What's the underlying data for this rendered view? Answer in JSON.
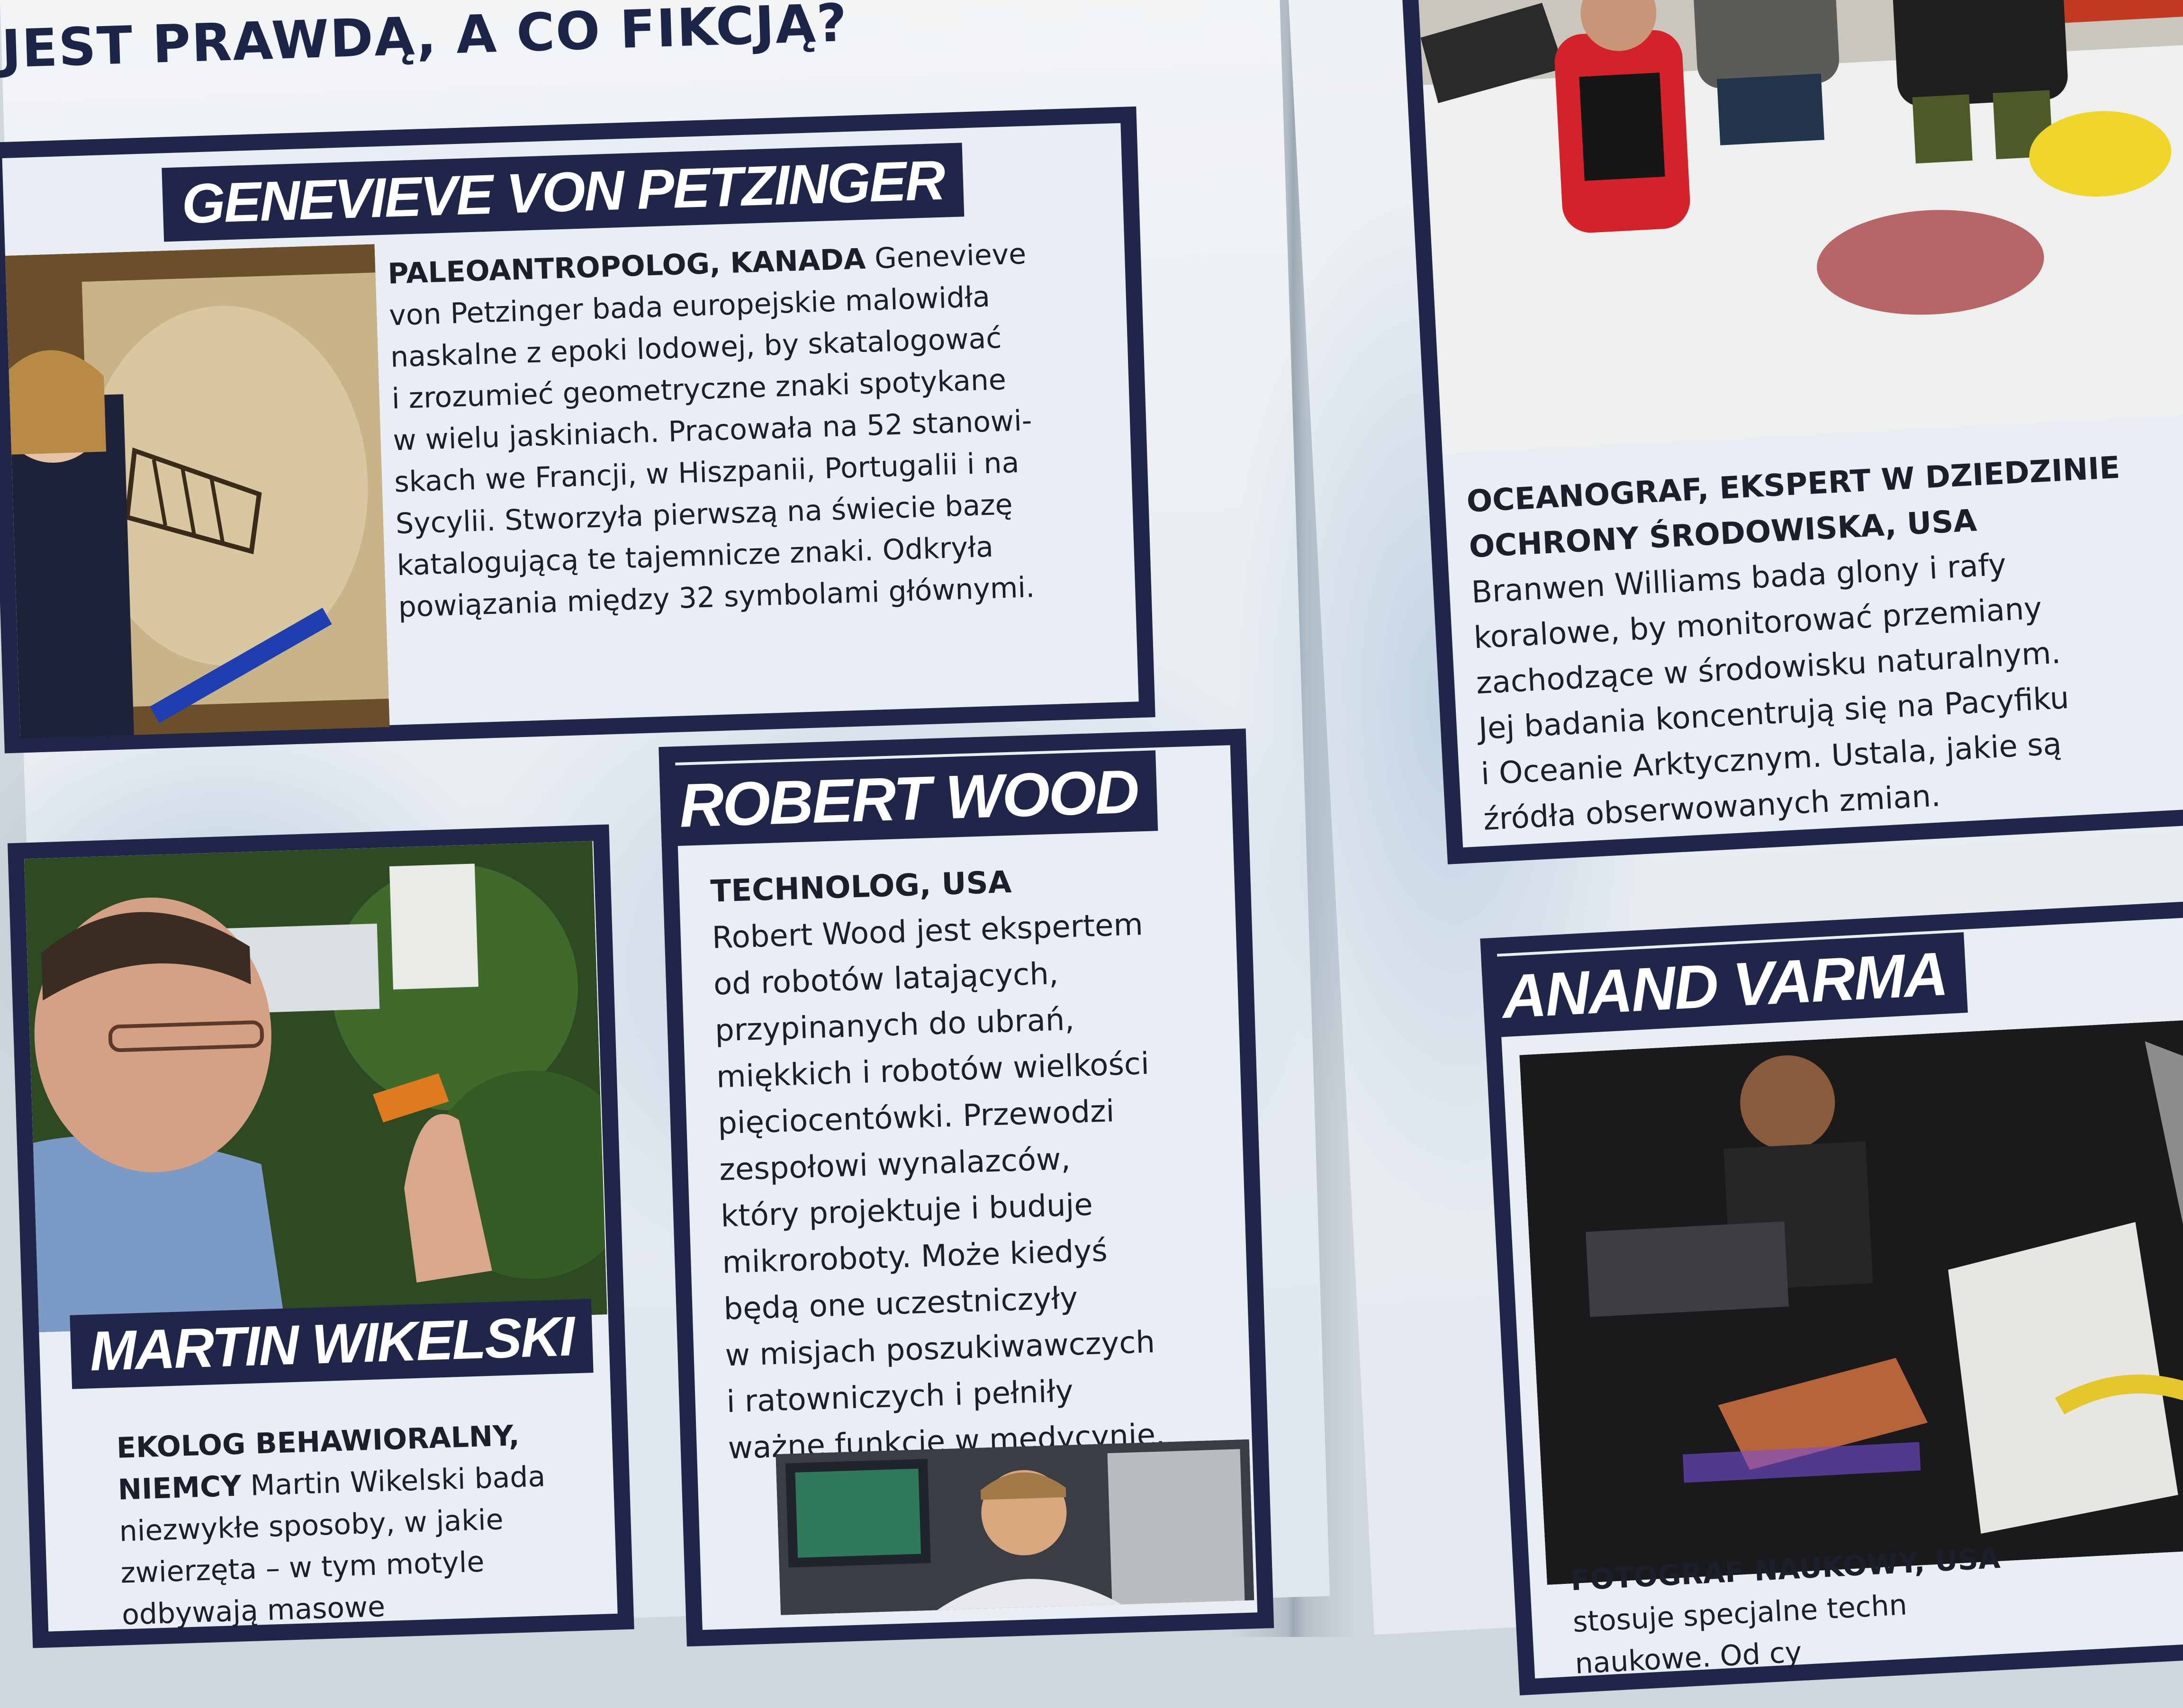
{
  "page_heading": "JEST PRAWDĄ, A CO FIKCJĄ?",
  "cards": {
    "petzinger": {
      "name": "GENEVIEVE VON PETZINGER",
      "role": "PALEOANTROPOLOG, KANADA",
      "lines": [
        "Genevieve",
        "von Petzinger bada europejskie malowidła",
        "naskalne z epoki lodowej, by skatalogować",
        "i zrozumieć geometryczne znaki spotykane",
        "w wielu jaskiniach. Pracowała na 52 stanowi-",
        "skach we Francji, w Hiszpanii, Portugalii i na",
        "Sycylii. Stworzyła pierwszą na świecie bazę",
        "katalogującą te tajemnicze znaki. Odkryła",
        "powiązania między 32 symbolami głównymi."
      ]
    },
    "wood": {
      "name": "ROBERT WOOD",
      "role": "TECHNOLOG, USA",
      "lines": [
        "Robert Wood jest ekspertem",
        "od robotów latających,",
        "przypinanych do ubrań,",
        "miękkich i robotów wielkości",
        "pięciocentówki. Przewodzi",
        "zespołowi wynalazców,",
        "który projektuje i buduje",
        "mikroroboty. Może kiedyś",
        "będą one uczestniczyły",
        "w misjach poszukiwawczych",
        "i ratowniczych i pełniły",
        "ważne funkcje w medycynie."
      ]
    },
    "wikelski": {
      "name": "MARTIN WIKELSKI",
      "role_line1": "EKOLOG BEHAWIORALNY,",
      "role_line2": "NIEMCY",
      "lines": [
        "Martin Wikelski bada",
        "niezwykłe sposoby, w jakie",
        "zwierzęta – w tym motyle",
        "odbywają masowe"
      ]
    },
    "williams": {
      "role_line1": "OCEANOGRAF, EKSPERT W DZIEDZINIE",
      "role_line2": "OCHRONY ŚRODOWISKA, USA",
      "lines": [
        "Branwen Williams bada glony i rafy",
        "koralowe, by monitorować przemiany",
        "zachodzące w środowisku naturalnym.",
        "Jej badania koncentrują się na Pacyfiku",
        "i Oceanie Arktycznym. Ustala, jakie są",
        "źródła obserwowanych zmian."
      ]
    },
    "varma": {
      "name": "ANAND VARMA",
      "role": "FOTOGRAF NAUKOWY, USA",
      "lines": [
        "stosuje specjalne techn",
        "naukowe. Od cy"
      ]
    }
  },
  "colors": {
    "navy": "#1f2649",
    "page": "#eef1f4",
    "watercolor": "#8fb0cf"
  }
}
